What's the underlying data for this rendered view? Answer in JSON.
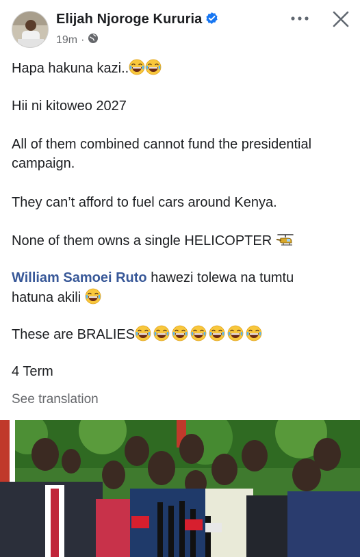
{
  "post": {
    "author": "Elijah Njoroge Kururia",
    "time": "19m",
    "separator": "·",
    "lines": {
      "l1": "Hapa hakuna kazi..",
      "l2": "Hii ni kitoweo 2027",
      "l3a": "All of them combined cannot fund the presidential",
      "l3b": "campaign.",
      "l4": "They can’t afford to fuel cars around Kenya.",
      "l5": "None of them owns a single HELICOPTER",
      "l6_mention": "William Samoei Ruto",
      "l6_rest": " hawezi tolewa na tumtu",
      "l6b": "hatuna akili",
      "l7": "These are BRALIES",
      "l8": "4 Term"
    },
    "see_translation": "See translation"
  },
  "icons": {
    "verified": "verified-badge-icon",
    "globe": "globe-icon",
    "more": "more-options-icon",
    "close": "close-icon",
    "emoji": "tears-of-joy-emoji-icon",
    "helicopter": "helicopter-emoji-icon"
  },
  "colors": {
    "verified": "#1877f2",
    "mention": "#385898",
    "secondary_text": "#65676b",
    "emoji_face": "#f8c73c"
  }
}
